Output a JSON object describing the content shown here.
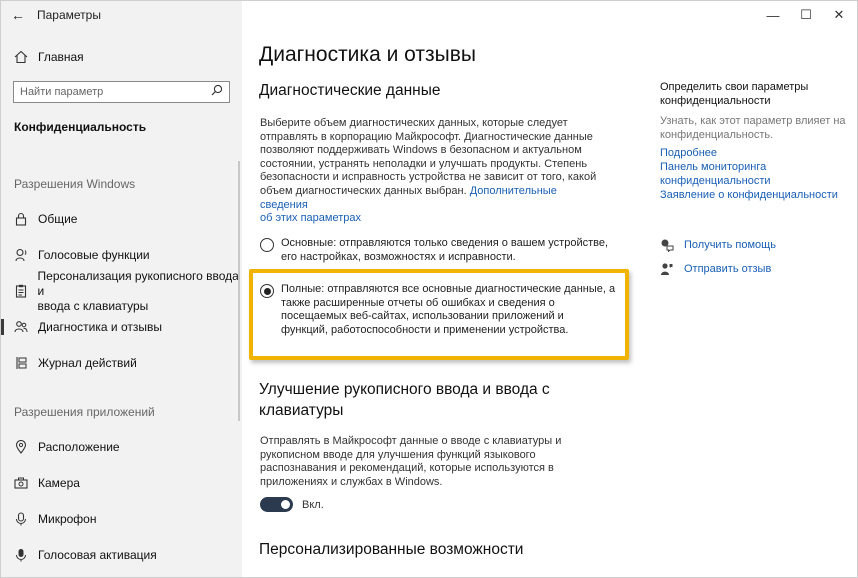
{
  "window": {
    "title": "Параметры",
    "back": "←",
    "controls": {
      "minimize": "—",
      "maximize": "☐",
      "close": "✕"
    }
  },
  "sidebar": {
    "home_label": "Главная",
    "search_placeholder": "Найти параметр",
    "section_title": "Конфиденциальность",
    "group_windows": "Разрешения Windows",
    "items_windows": [
      {
        "label": "Общие",
        "icon": "lock-icon"
      },
      {
        "label": "Голосовые функции",
        "icon": "speech-icon"
      },
      {
        "label": "Персонализация рукописного ввода и",
        "label2": "ввода с клавиатуры",
        "icon": "clipboard-icon"
      },
      {
        "label": "Диагностика и отзывы",
        "icon": "people-icon",
        "active": true
      },
      {
        "label": "Журнал действий",
        "icon": "timeline-icon"
      }
    ],
    "group_apps": "Разрешения приложений",
    "items_apps": [
      {
        "label": "Расположение",
        "icon": "location-icon"
      },
      {
        "label": "Камера",
        "icon": "camera-icon"
      },
      {
        "label": "Микрофон",
        "icon": "microphone-icon"
      },
      {
        "label": "Голосовая активация",
        "icon": "voice-activation-icon"
      }
    ]
  },
  "main": {
    "page_title": "Диагностика и отзывы",
    "section1_title": "Диагностические данные",
    "section1_lines": [
      "Выберите объем диагностических данных, которые следует",
      "отправлять в корпорацию Майкрософт. Диагностические данные",
      "позволяют поддерживать Windows в безопасном и актуальном",
      "состоянии, устранять неполадки и улучшать продукты. Степень",
      "безопасности и исправность устройства не зависит от того, какой",
      "объем диагностических данных выбран."
    ],
    "section1_link_part1": "Дополнительные сведения",
    "section1_link_part2": "об этих параметрах",
    "option_basic_line1": "Основные: отправляются только сведения о вашем устройстве,",
    "option_basic_line2": "его настройках, возможностях и исправности.",
    "option_full_lines": [
      "Полные: отправляются все основные диагностические данные, а",
      "также расширенные отчеты об ошибках и сведения о",
      "посещаемых веб-сайтах, использовании приложений и",
      "функций, работоспособности и применении устройства."
    ],
    "option_selected": "full",
    "section2_title_line1": "Улучшение рукописного ввода и ввода с",
    "section2_title_line2": "клавиатуры",
    "section2_lines": [
      "Отправлять в Майкрософт данные о вводе с клавиатуры и",
      "рукописном вводе для улучшения функций языкового",
      "распознавания и рекомендаций, которые используются в",
      "приложениях и службах в Windows."
    ],
    "toggle_label": "Вкл.",
    "toggle_on": true,
    "section3_title": "Персонализированные возможности"
  },
  "right": {
    "title_line1": "Определить свои параметры",
    "title_line2": "конфиденциальности",
    "muted_line1": "Узнать, как этот параметр влияет на",
    "muted_line2": "конфиденциальность.",
    "link_more": "Подробнее",
    "link_dashboard_line1": "Панель мониторинга",
    "link_dashboard_line2": "конфиденциальности",
    "link_statement": "Заявление о конфиденциальности",
    "help": "Получить помощь",
    "feedback": "Отправить отзыв"
  },
  "colors": {
    "accent": "#1a5fb4",
    "highlight": "#f0b400",
    "toggle": "#2b3a4e"
  }
}
